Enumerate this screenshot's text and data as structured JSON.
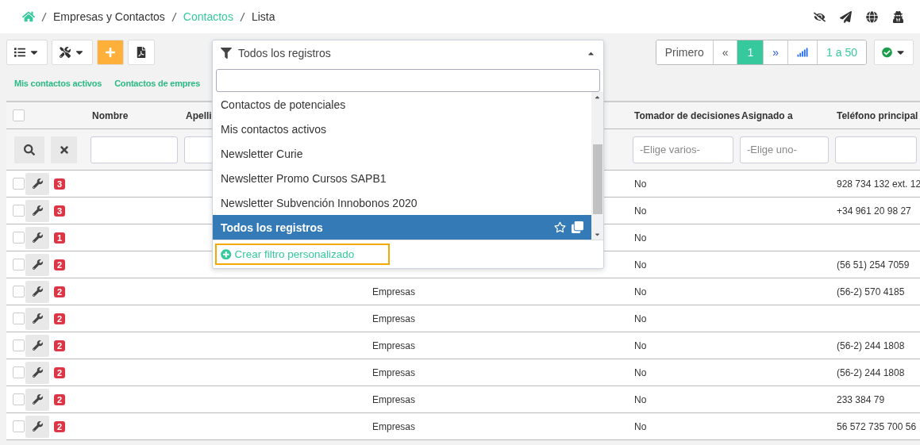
{
  "breadcrumb": [
    {
      "label": "Empresas y Contactos",
      "link": false
    },
    {
      "label": "Contactos",
      "link": true
    },
    {
      "label": "Lista",
      "link": false
    }
  ],
  "quick_filters": [
    "Mis contactos activos",
    "Contactos de empres"
  ],
  "filter_select": {
    "value": "Todos los registros",
    "options": [
      {
        "label": "Contactos de potenciales",
        "selected": false
      },
      {
        "label": "Mis contactos activos",
        "selected": false
      },
      {
        "label": "Newsletter Curie",
        "selected": false
      },
      {
        "label": "Newsletter Promo Cursos SAPB1",
        "selected": false
      },
      {
        "label": "Newsletter Subvención Innobonos 2020",
        "selected": false
      },
      {
        "label": "Todos los registros",
        "selected": true
      }
    ],
    "action": "Crear filtro personalizado"
  },
  "pagination": {
    "first": "Primero",
    "prev": "«",
    "pages": [
      {
        "label": "1",
        "selected": true
      }
    ],
    "next": "»",
    "range": "1 a 50"
  },
  "table": {
    "select_all_checked": false,
    "columns": [
      {
        "label": "Nombre",
        "kind": "input"
      },
      {
        "label": "Apelli",
        "kind": "input"
      },
      {
        "kind": "none"
      },
      {
        "kind": "none"
      },
      {
        "label": "Tomador de decisiones",
        "kind": "select",
        "placeholder": "-Elige varios-"
      },
      {
        "label": "Asignado a",
        "kind": "select",
        "placeholder": "-Elige uno-"
      },
      {
        "label": "Teléfono principal",
        "kind": "input"
      }
    ],
    "rows": [
      {
        "checked": false,
        "count": "3",
        "decision": "No",
        "phone": "928 734 132 ext. 12"
      },
      {
        "checked": false,
        "count": "3",
        "decision": "No",
        "phone": "+34 961 20 98 27"
      },
      {
        "checked": false,
        "count": "1",
        "decision": "No"
      },
      {
        "checked": false,
        "count": "2",
        "decision": "No",
        "phone": "(56 51) 254 7059"
      },
      {
        "checked": false,
        "count": "2",
        "column_3": "Empresas",
        "decision": "No",
        "phone": "(56-2) 570 4185"
      },
      {
        "checked": false,
        "count": "2",
        "column_3": "Empresas",
        "decision": "No"
      },
      {
        "checked": false,
        "count": "2",
        "column_3": "Empresas",
        "decision": "No",
        "phone": "(56-2) 244 1808"
      },
      {
        "checked": false,
        "count": "2",
        "column_3": "Empresas",
        "decision": "No",
        "phone": "(56-2) 244 1808"
      },
      {
        "checked": false,
        "count": "2",
        "column_3": "Empresas",
        "decision": "No",
        "phone": "233 384 79"
      },
      {
        "checked": false,
        "count": "2",
        "column_3": "Empresas",
        "decision": "No",
        "phone": "56 572 735 700 56"
      }
    ]
  }
}
